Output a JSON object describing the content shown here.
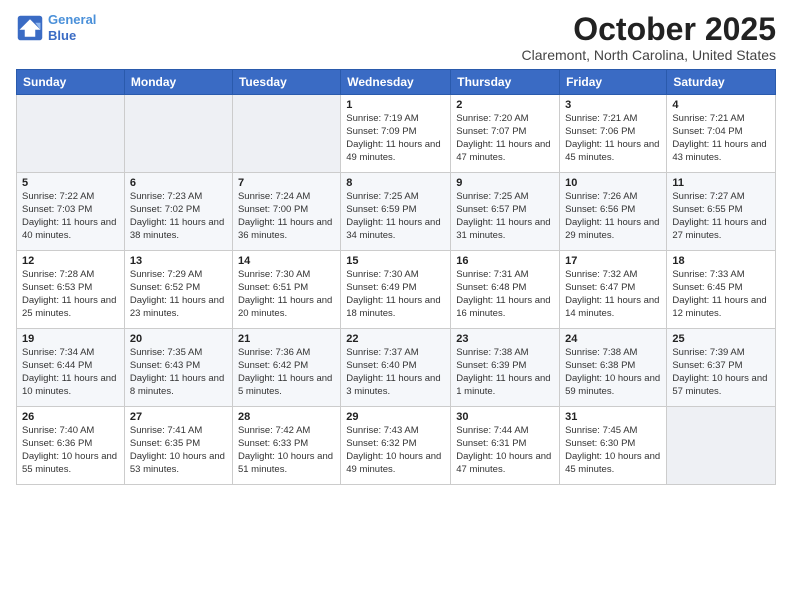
{
  "header": {
    "logo_line1": "General",
    "logo_line2": "Blue",
    "month": "October 2025",
    "location": "Claremont, North Carolina, United States"
  },
  "weekdays": [
    "Sunday",
    "Monday",
    "Tuesday",
    "Wednesday",
    "Thursday",
    "Friday",
    "Saturday"
  ],
  "weeks": [
    [
      {
        "day": "",
        "info": ""
      },
      {
        "day": "",
        "info": ""
      },
      {
        "day": "",
        "info": ""
      },
      {
        "day": "1",
        "info": "Sunrise: 7:19 AM\nSunset: 7:09 PM\nDaylight: 11 hours\nand 49 minutes."
      },
      {
        "day": "2",
        "info": "Sunrise: 7:20 AM\nSunset: 7:07 PM\nDaylight: 11 hours\nand 47 minutes."
      },
      {
        "day": "3",
        "info": "Sunrise: 7:21 AM\nSunset: 7:06 PM\nDaylight: 11 hours\nand 45 minutes."
      },
      {
        "day": "4",
        "info": "Sunrise: 7:21 AM\nSunset: 7:04 PM\nDaylight: 11 hours\nand 43 minutes."
      }
    ],
    [
      {
        "day": "5",
        "info": "Sunrise: 7:22 AM\nSunset: 7:03 PM\nDaylight: 11 hours\nand 40 minutes."
      },
      {
        "day": "6",
        "info": "Sunrise: 7:23 AM\nSunset: 7:02 PM\nDaylight: 11 hours\nand 38 minutes."
      },
      {
        "day": "7",
        "info": "Sunrise: 7:24 AM\nSunset: 7:00 PM\nDaylight: 11 hours\nand 36 minutes."
      },
      {
        "day": "8",
        "info": "Sunrise: 7:25 AM\nSunset: 6:59 PM\nDaylight: 11 hours\nand 34 minutes."
      },
      {
        "day": "9",
        "info": "Sunrise: 7:25 AM\nSunset: 6:57 PM\nDaylight: 11 hours\nand 31 minutes."
      },
      {
        "day": "10",
        "info": "Sunrise: 7:26 AM\nSunset: 6:56 PM\nDaylight: 11 hours\nand 29 minutes."
      },
      {
        "day": "11",
        "info": "Sunrise: 7:27 AM\nSunset: 6:55 PM\nDaylight: 11 hours\nand 27 minutes."
      }
    ],
    [
      {
        "day": "12",
        "info": "Sunrise: 7:28 AM\nSunset: 6:53 PM\nDaylight: 11 hours\nand 25 minutes."
      },
      {
        "day": "13",
        "info": "Sunrise: 7:29 AM\nSunset: 6:52 PM\nDaylight: 11 hours\nand 23 minutes."
      },
      {
        "day": "14",
        "info": "Sunrise: 7:30 AM\nSunset: 6:51 PM\nDaylight: 11 hours\nand 20 minutes."
      },
      {
        "day": "15",
        "info": "Sunrise: 7:30 AM\nSunset: 6:49 PM\nDaylight: 11 hours\nand 18 minutes."
      },
      {
        "day": "16",
        "info": "Sunrise: 7:31 AM\nSunset: 6:48 PM\nDaylight: 11 hours\nand 16 minutes."
      },
      {
        "day": "17",
        "info": "Sunrise: 7:32 AM\nSunset: 6:47 PM\nDaylight: 11 hours\nand 14 minutes."
      },
      {
        "day": "18",
        "info": "Sunrise: 7:33 AM\nSunset: 6:45 PM\nDaylight: 11 hours\nand 12 minutes."
      }
    ],
    [
      {
        "day": "19",
        "info": "Sunrise: 7:34 AM\nSunset: 6:44 PM\nDaylight: 11 hours\nand 10 minutes."
      },
      {
        "day": "20",
        "info": "Sunrise: 7:35 AM\nSunset: 6:43 PM\nDaylight: 11 hours\nand 8 minutes."
      },
      {
        "day": "21",
        "info": "Sunrise: 7:36 AM\nSunset: 6:42 PM\nDaylight: 11 hours\nand 5 minutes."
      },
      {
        "day": "22",
        "info": "Sunrise: 7:37 AM\nSunset: 6:40 PM\nDaylight: 11 hours\nand 3 minutes."
      },
      {
        "day": "23",
        "info": "Sunrise: 7:38 AM\nSunset: 6:39 PM\nDaylight: 11 hours\nand 1 minute."
      },
      {
        "day": "24",
        "info": "Sunrise: 7:38 AM\nSunset: 6:38 PM\nDaylight: 10 hours\nand 59 minutes."
      },
      {
        "day": "25",
        "info": "Sunrise: 7:39 AM\nSunset: 6:37 PM\nDaylight: 10 hours\nand 57 minutes."
      }
    ],
    [
      {
        "day": "26",
        "info": "Sunrise: 7:40 AM\nSunset: 6:36 PM\nDaylight: 10 hours\nand 55 minutes."
      },
      {
        "day": "27",
        "info": "Sunrise: 7:41 AM\nSunset: 6:35 PM\nDaylight: 10 hours\nand 53 minutes."
      },
      {
        "day": "28",
        "info": "Sunrise: 7:42 AM\nSunset: 6:33 PM\nDaylight: 10 hours\nand 51 minutes."
      },
      {
        "day": "29",
        "info": "Sunrise: 7:43 AM\nSunset: 6:32 PM\nDaylight: 10 hours\nand 49 minutes."
      },
      {
        "day": "30",
        "info": "Sunrise: 7:44 AM\nSunset: 6:31 PM\nDaylight: 10 hours\nand 47 minutes."
      },
      {
        "day": "31",
        "info": "Sunrise: 7:45 AM\nSunset: 6:30 PM\nDaylight: 10 hours\nand 45 minutes."
      },
      {
        "day": "",
        "info": ""
      }
    ]
  ]
}
